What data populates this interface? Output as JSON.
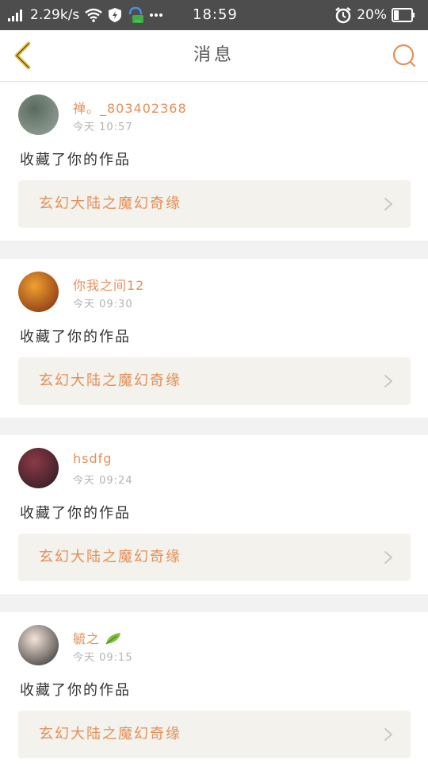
{
  "statusbar": {
    "speed": "2.29k/s",
    "time": "18:59",
    "battery": "20%",
    "icons": [
      "signal-icon",
      "wifi-icon",
      "shield-icon",
      "chat-lock-icon",
      "more-icon",
      "alarm-icon",
      "battery-icon"
    ]
  },
  "navbar": {
    "title": "消息",
    "back_icon": "chevron-left-icon",
    "search_icon": "search-icon",
    "accent": "#e58f58"
  },
  "messages": [
    {
      "username": "禅。_803402368",
      "time": "今天 10:57",
      "action": "收藏了你的作品",
      "work": "玄幻大陆之魔幻奇缘",
      "avatar_colors": [
        "#5a6b5e",
        "#9aa59b"
      ]
    },
    {
      "username": "你我之间12",
      "time": "今天 09:30",
      "action": "收藏了你的作品",
      "work": "玄幻大陆之魔幻奇缘",
      "avatar_colors": [
        "#f0a030",
        "#7a2a10"
      ]
    },
    {
      "username": "hsdfg",
      "time": "今天 09:24",
      "action": "收藏了你的作品",
      "work": "玄幻大陆之魔幻奇缘",
      "avatar_colors": [
        "#8a3a48",
        "#2a1a20"
      ]
    },
    {
      "username": "毓之",
      "time": "今天 09:15",
      "action": "收藏了你的作品",
      "work": "玄幻大陆之魔幻奇缘",
      "avatar_colors": [
        "#f4e4d8",
        "#2a2a2a"
      ]
    }
  ]
}
